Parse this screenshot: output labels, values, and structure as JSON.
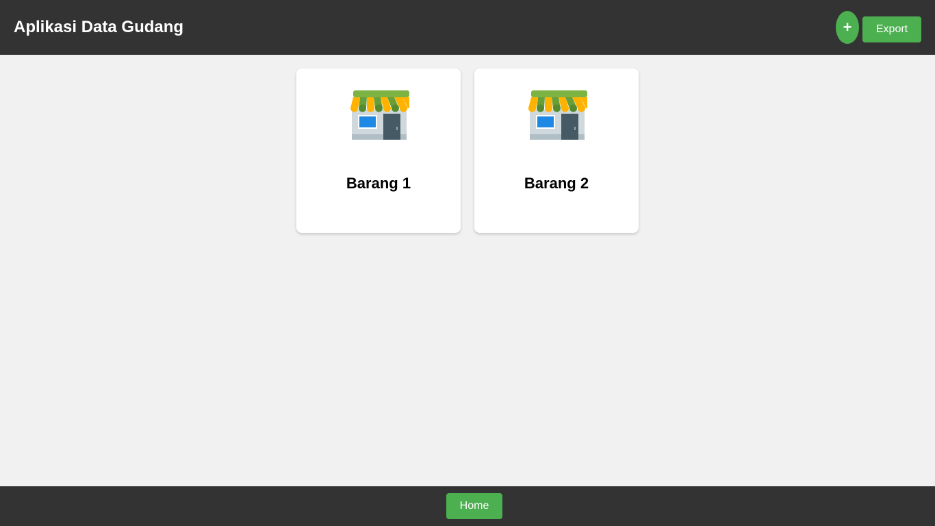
{
  "header": {
    "title": "Aplikasi Data Gudang",
    "add_label": "+",
    "export_label": "Export"
  },
  "cards": [
    {
      "title": "Barang 1",
      "icon": "store-icon"
    },
    {
      "title": "Barang 2",
      "icon": "store-icon"
    }
  ],
  "footer": {
    "home_label": "Home"
  },
  "colors": {
    "bar_background": "#333333",
    "page_background": "#f1f1f1",
    "accent_green": "#4caf50",
    "card_background": "#ffffff"
  }
}
